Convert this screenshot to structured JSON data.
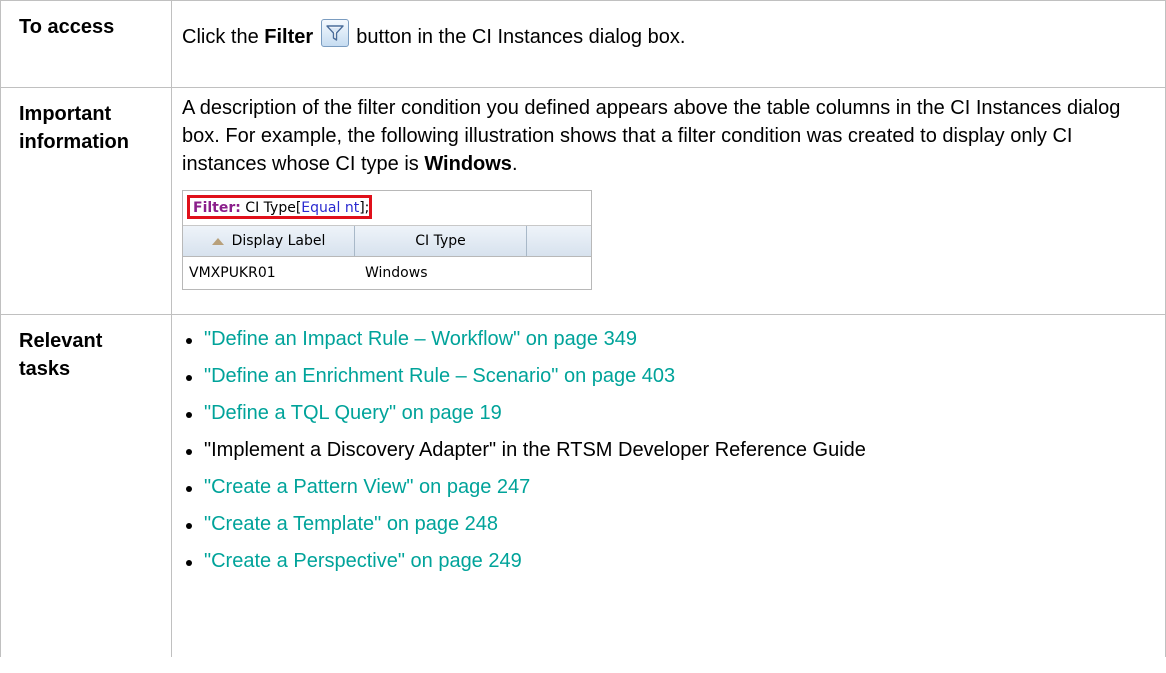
{
  "access": {
    "heading": "To access",
    "text_before": "Click the ",
    "bold": "Filter",
    "icon": "filter-funnel-icon",
    "text_after": " button in the CI Instances dialog box."
  },
  "important": {
    "heading_line1": "Important",
    "heading_line2": "information",
    "text": "A description of the filter condition you defined appears above the table columns in the CI Instances dialog box. For example, the following illustration shows that a filter condition was created to display only CI instances whose CI type is ",
    "bold": "Windows",
    "end": ".",
    "illustration": {
      "filter_label": "Filter:",
      "filter_text_a": " CI Type[",
      "filter_value": "Equal nt",
      "filter_text_b": "];",
      "col1": "Display Label",
      "col2": "CI Type",
      "row_label": "VMXPUKR01",
      "row_type": "Windows",
      "highlight_color": "#e0101a"
    }
  },
  "tasks": {
    "heading_line1": "Relevant",
    "heading_line2": "tasks",
    "items": [
      {
        "text": "\"Define an Impact Rule – Workflow\" on page 349",
        "link": true
      },
      {
        "text": "\"Define an Enrichment Rule – Scenario\" on page 403",
        "link": true
      },
      {
        "text": "\"Define a TQL Query\" on page 19",
        "link": true
      },
      {
        "text": "\"Implement a Discovery Adapter\" in the RTSM Developer Reference Guide",
        "link": false
      },
      {
        "text": "\"Create a Pattern View\" on page 247",
        "link": true
      },
      {
        "text": "\"Create a Template\" on page 248",
        "link": true
      },
      {
        "text": "\"Create a Perspective\" on page 249",
        "link": true
      }
    ]
  },
  "colors": {
    "link": "#00a39a",
    "border": "#c0c0c0"
  }
}
